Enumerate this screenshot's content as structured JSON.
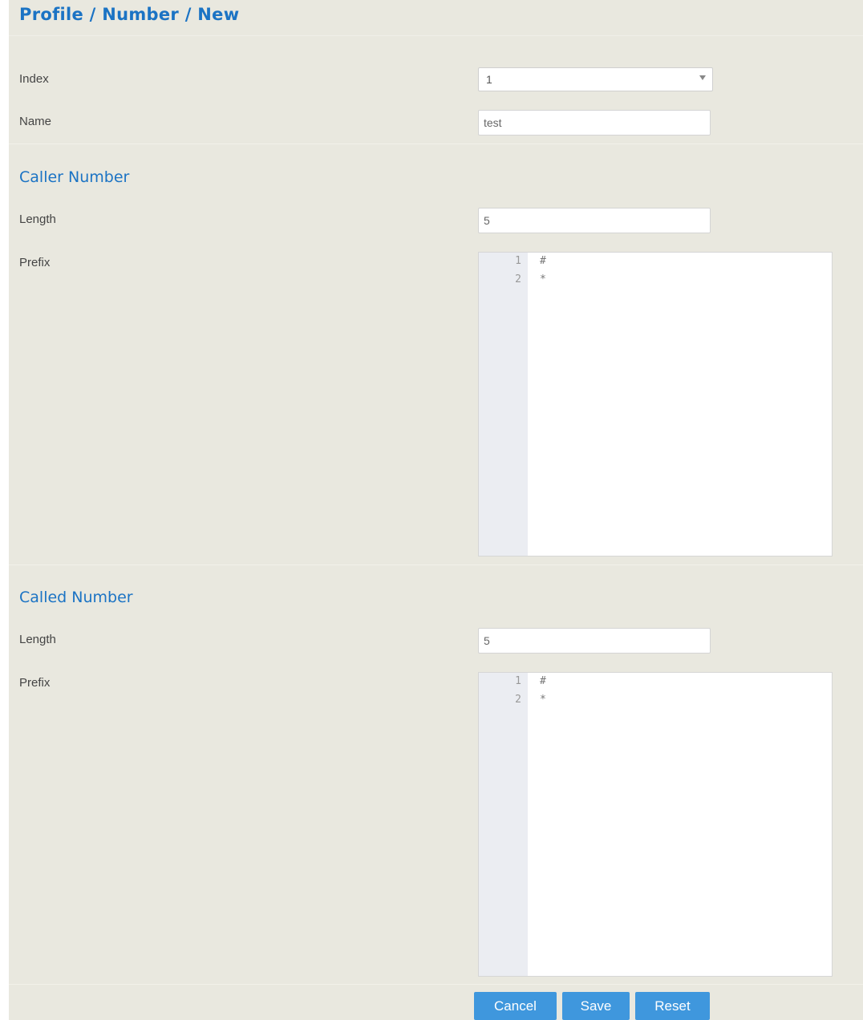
{
  "breadcrumb": {
    "title": "Profile / Number / New"
  },
  "general": {
    "index_label": "Index",
    "index_value": "1",
    "name_label": "Name",
    "name_value": "test"
  },
  "caller": {
    "heading": "Caller Number",
    "length_label": "Length",
    "length_value": "5",
    "prefix_label": "Prefix",
    "prefix_lines": [
      {
        "num": "1",
        "text": "#"
      },
      {
        "num": "2",
        "text": "*"
      }
    ]
  },
  "called": {
    "heading": "Called Number",
    "length_label": "Length",
    "length_value": "5",
    "prefix_label": "Prefix",
    "prefix_lines": [
      {
        "num": "1",
        "text": "#"
      },
      {
        "num": "2",
        "text": "*"
      }
    ]
  },
  "actions": {
    "cancel": "Cancel",
    "save": "Save",
    "reset": "Reset"
  },
  "colors": {
    "heading": "#1b73c4",
    "button": "#3f97dd",
    "background": "#e9e8df",
    "gutter": "#ebedf2"
  },
  "icons": {
    "select_arrow": "chevron-down-icon"
  }
}
